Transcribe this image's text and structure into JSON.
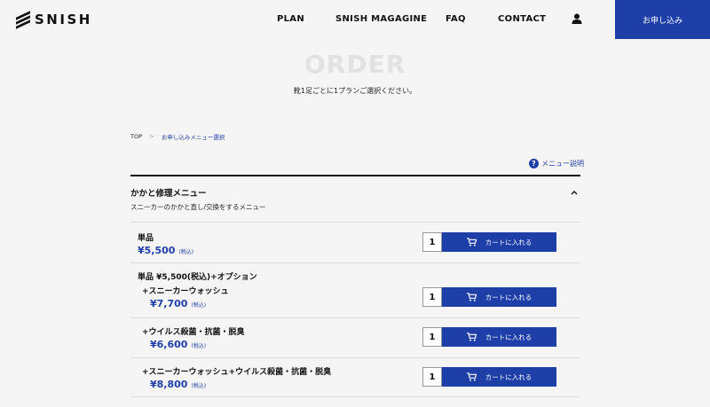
{
  "header": {
    "logo_text": "SNISH",
    "nav": [
      "PLAN",
      "SNISH MAGAGINE",
      "FAQ",
      "CONTACT"
    ],
    "apply_label": "お申し込み"
  },
  "page": {
    "title": "ORDER",
    "subtitle": "靴1足ごとに1プランご選択ください。"
  },
  "breadcrumb": {
    "top": "TOP",
    "separator": ">",
    "current": "お申し込みメニュー選択"
  },
  "help": {
    "icon_text": "?",
    "label": "メニュー説明"
  },
  "section": {
    "title": "かかと修理メニュー",
    "description": "スニーカーのかかと直し/交換をするメニュー"
  },
  "rows": [
    {
      "title": "単品",
      "price": "¥5,500",
      "tax": "(税込)",
      "qty": "1",
      "cart_label": "カートに入れる"
    },
    {
      "title": "+スニーカーウォッシュ",
      "price": "¥7,700",
      "tax": "(税込)",
      "qty": "1",
      "cart_label": "カートに入れる"
    },
    {
      "title": "+ウイルス殺菌・抗菌・脱臭",
      "price": "¥6,600",
      "tax": "(税込)",
      "qty": "1",
      "cart_label": "カートに入れる"
    },
    {
      "title": "+スニーカーウォッシュ+ウイルス殺菌・抗菌・脱臭",
      "price": "¥8,800",
      "tax": "(税込)",
      "qty": "1",
      "cart_label": "カートに入れる"
    }
  ],
  "option_group_label": "単品 ¥5,500(税込)+オプション",
  "colors": {
    "accent": "#1e3fa8",
    "background": "#f5f5f5",
    "title_ghost": "#e2e2e2"
  },
  "icons": [
    "user-icon",
    "help-icon",
    "chevron-up-icon",
    "cart-icon"
  ]
}
